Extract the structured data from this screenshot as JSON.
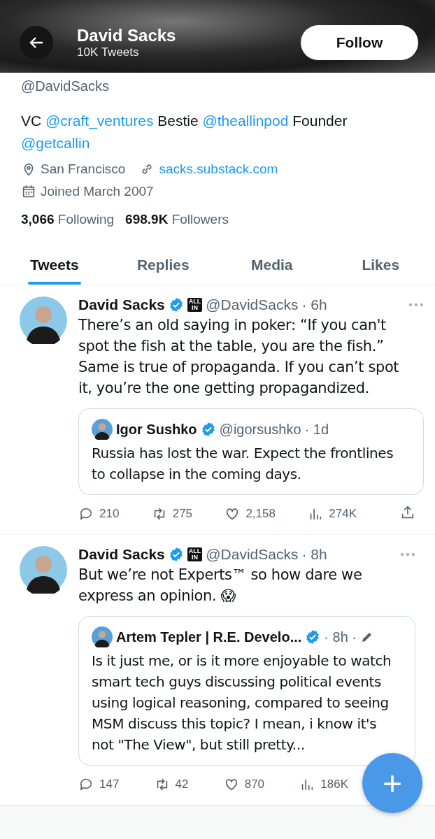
{
  "header": {
    "name": "David Sacks",
    "tweet_count": "10K Tweets",
    "follow_button": "Follow"
  },
  "profile": {
    "handle": "@DavidSacks",
    "bio": [
      {
        "kind": "text",
        "text": "VC "
      },
      {
        "kind": "mention",
        "text": "@craft_ventures"
      },
      {
        "kind": "text",
        "text": " Bestie "
      },
      {
        "kind": "mention",
        "text": "@theallinpod"
      },
      {
        "kind": "text",
        "text": " Founder "
      },
      {
        "kind": "mention",
        "text": "@getcallin"
      }
    ],
    "location": "San Francisco",
    "website": "sacks.substack.com",
    "joined": "Joined March 2007",
    "following_count": "3,066",
    "following_label": "Following",
    "followers_count": "698.9K",
    "followers_label": "Followers"
  },
  "tabs": [
    {
      "label": "Tweets",
      "selected": true
    },
    {
      "label": "Replies",
      "selected": false
    },
    {
      "label": "Media",
      "selected": false
    },
    {
      "label": "Likes",
      "selected": false
    }
  ],
  "tweets": [
    {
      "name": "David Sacks",
      "verified": true,
      "badge": [
        "ALL",
        "IN"
      ],
      "handle": "@DavidSacks",
      "time": "· 6h",
      "text": "There’s an old saying in poker: “If you can't spot the fish at the table, you are the fish.” Same is true of propaganda. If you can’t spot it, you’re the one getting propagandized.",
      "quote": {
        "name": "Igor Sushko",
        "verified": true,
        "handle": "@igorsushko",
        "time": "· 1d",
        "edited": false,
        "text": "Russia has lost the war. Expect the frontlines to collapse in the coming days."
      },
      "replies": "210",
      "retweets": "275",
      "likes": "2,158",
      "views": "274K"
    },
    {
      "name": "David Sacks",
      "verified": true,
      "badge": [
        "ALL",
        "IN"
      ],
      "handle": "@DavidSacks",
      "time": "· 8h",
      "text": "But we’re not Experts™ so how dare we express an opinion. 😱",
      "quote": {
        "name": "Artem Tepler | R.E. Develo...",
        "verified": true,
        "time": "· 8h ·",
        "edited": true,
        "text": "Is it just me, or is it more enjoyable to watch smart tech guys discussing political events using logical reasoning, compared to seeing MSM discuss this topic? I mean, i know it's not \"The View\", but still pretty..."
      },
      "replies": "147",
      "retweets": "42",
      "likes": "870",
      "views": "186K"
    }
  ],
  "compose_button": "+"
}
